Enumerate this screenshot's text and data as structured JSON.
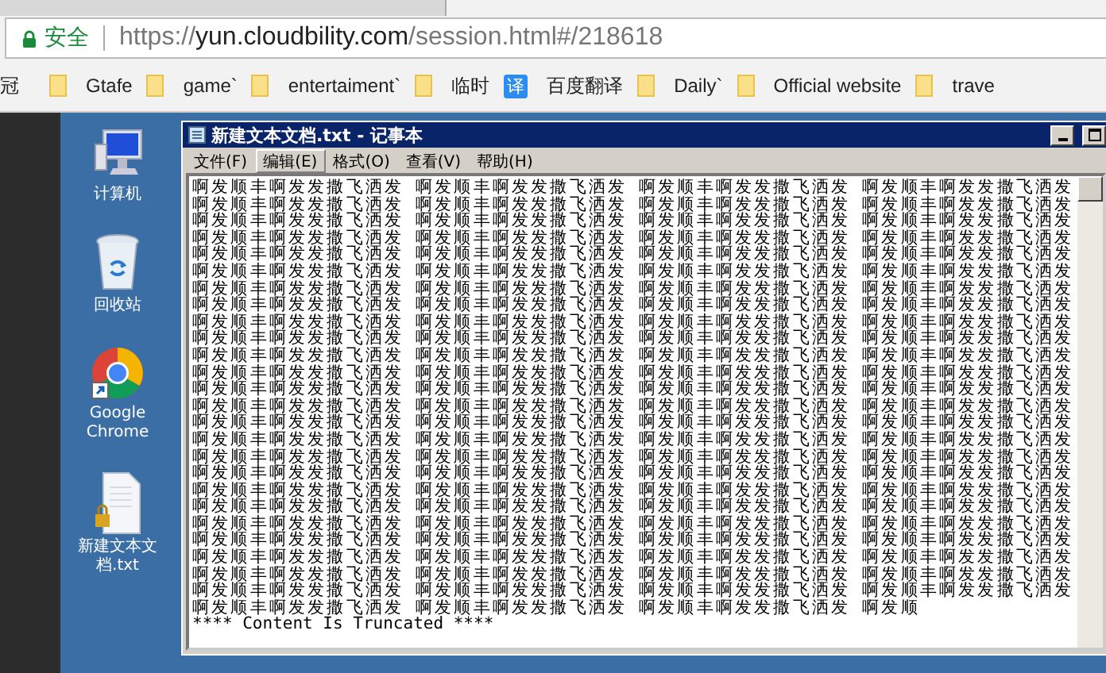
{
  "browser": {
    "security_label": "安全",
    "url_scheme": "https://",
    "url_host": "yun.cloudbility.com",
    "url_path": "/session.html#/218618",
    "bookmarks": [
      {
        "kind": "text",
        "label": "冠"
      },
      {
        "kind": "folder",
        "label": "Gtafe"
      },
      {
        "kind": "folder",
        "label": "game`"
      },
      {
        "kind": "folder",
        "label": "entertaiment`"
      },
      {
        "kind": "folder",
        "label": "临时"
      },
      {
        "kind": "app",
        "icon_text": "译",
        "label": "百度翻译"
      },
      {
        "kind": "folder",
        "label": "Daily`"
      },
      {
        "kind": "folder",
        "label": "Official website"
      },
      {
        "kind": "folder",
        "label": "trave"
      }
    ]
  },
  "desktop_icons": [
    {
      "kind": "computer",
      "label": "计算机"
    },
    {
      "kind": "recycle-bin",
      "label": "回收站"
    },
    {
      "kind": "browser",
      "label": "Google Chrome"
    },
    {
      "kind": "text-file",
      "label": "新建文本文档.txt"
    }
  ],
  "notepad": {
    "title": "新建文本文档.txt - 记事本",
    "menu": [
      {
        "label": "文件(F)",
        "highlighted": false
      },
      {
        "label": "编辑(E)",
        "highlighted": true
      },
      {
        "label": "格式(O)",
        "highlighted": false
      },
      {
        "label": "查看(V)",
        "highlighted": false
      },
      {
        "label": "帮助(H)",
        "highlighted": false
      }
    ],
    "lines": [
      "啊发顺丰啊发发撒飞洒发 啊发顺丰啊发发撒飞洒发 啊发顺丰啊发发撒飞洒发 啊发顺丰啊发发撒飞洒发",
      "啊发顺丰啊发发撒飞洒发 啊发顺丰啊发发撒飞洒发 啊发顺丰啊发发撒飞洒发 啊发顺丰啊发发撒飞洒发",
      "啊发顺丰啊发发撒飞洒发 啊发顺丰啊发发撒飞洒发 啊发顺丰啊发发撒飞洒发 啊发顺丰啊发发撒飞洒发",
      "啊发顺丰啊发发撒飞洒发 啊发顺丰啊发发撒飞洒发 啊发顺丰啊发发撒飞洒发 啊发顺丰啊发发撒飞洒发",
      "啊发顺丰啊发发撒飞洒发 啊发顺丰啊发发撒飞洒发 啊发顺丰啊发发撒飞洒发 啊发顺丰啊发发撒飞洒发",
      "啊发顺丰啊发发撒飞洒发 啊发顺丰啊发发撒飞洒发 啊发顺丰啊发发撒飞洒发 啊发顺丰啊发发撒飞洒发",
      "啊发顺丰啊发发撒飞洒发 啊发顺丰啊发发撒飞洒发 啊发顺丰啊发发撒飞洒发 啊发顺丰啊发发撒飞洒发",
      "啊发顺丰啊发发撒飞洒发 啊发顺丰啊发发撒飞洒发 啊发顺丰啊发发撒飞洒发 啊发顺丰啊发发撒飞洒发",
      "啊发顺丰啊发发撒飞洒发 啊发顺丰啊发发撒飞洒发 啊发顺丰啊发发撒飞洒发 啊发顺丰啊发发撒飞洒发",
      "啊发顺丰啊发发撒飞洒发 啊发顺丰啊发发撒飞洒发 啊发顺丰啊发发撒飞洒发 啊发顺丰啊发发撒飞洒发",
      "啊发顺丰啊发发撒飞洒发 啊发顺丰啊发发撒飞洒发 啊发顺丰啊发发撒飞洒发 啊发顺丰啊发发撒飞洒发",
      "啊发顺丰啊发发撒飞洒发 啊发顺丰啊发发撒飞洒发 啊发顺丰啊发发撒飞洒发 啊发顺丰啊发发撒飞洒发",
      "啊发顺丰啊发发撒飞洒发 啊发顺丰啊发发撒飞洒发 啊发顺丰啊发发撒飞洒发 啊发顺丰啊发发撒飞洒发",
      "啊发顺丰啊发发撒飞洒发 啊发顺丰啊发发撒飞洒发 啊发顺丰啊发发撒飞洒发 啊发顺丰啊发发撒飞洒发",
      "啊发顺丰啊发发撒飞洒发 啊发顺丰啊发发撒飞洒发 啊发顺丰啊发发撒飞洒发 啊发顺丰啊发发撒飞洒发",
      "啊发顺丰啊发发撒飞洒发 啊发顺丰啊发发撒飞洒发 啊发顺丰啊发发撒飞洒发 啊发顺丰啊发发撒飞洒发",
      "啊发顺丰啊发发撒飞洒发 啊发顺丰啊发发撒飞洒发 啊发顺丰啊发发撒飞洒发 啊发顺丰啊发发撒飞洒发",
      "啊发顺丰啊发发撒飞洒发 啊发顺丰啊发发撒飞洒发 啊发顺丰啊发发撒飞洒发 啊发顺丰啊发发撒飞洒发",
      "啊发顺丰啊发发撒飞洒发 啊发顺丰啊发发撒飞洒发 啊发顺丰啊发发撒飞洒发 啊发顺丰啊发发撒飞洒发",
      "啊发顺丰啊发发撒飞洒发 啊发顺丰啊发发撒飞洒发 啊发顺丰啊发发撒飞洒发 啊发顺丰啊发发撒飞洒发",
      "啊发顺丰啊发发撒飞洒发 啊发顺丰啊发发撒飞洒发 啊发顺丰啊发发撒飞洒发 啊发顺丰啊发发撒飞洒发",
      "啊发顺丰啊发发撒飞洒发 啊发顺丰啊发发撒飞洒发 啊发顺丰啊发发撒飞洒发 啊发顺丰啊发发撒飞洒发",
      "啊发顺丰啊发发撒飞洒发 啊发顺丰啊发发撒飞洒发 啊发顺丰啊发发撒飞洒发 啊发顺丰啊发发撒飞洒发",
      "啊发顺丰啊发发撒飞洒发 啊发顺丰啊发发撒飞洒发 啊发顺丰啊发发撒飞洒发 啊发顺丰啊发发撒飞洒发",
      "啊发顺丰啊发发撒飞洒发 啊发顺丰啊发发撒飞洒发 啊发顺丰啊发发撒飞洒发 啊发顺丰啊发发撒飞洒发",
      "啊发顺丰啊发发撒飞洒发 啊发顺丰啊发发撒飞洒发 啊发顺丰啊发发撒飞洒发 啊发顺"
    ],
    "truncation_note": "**** Content Is Truncated ****"
  }
}
